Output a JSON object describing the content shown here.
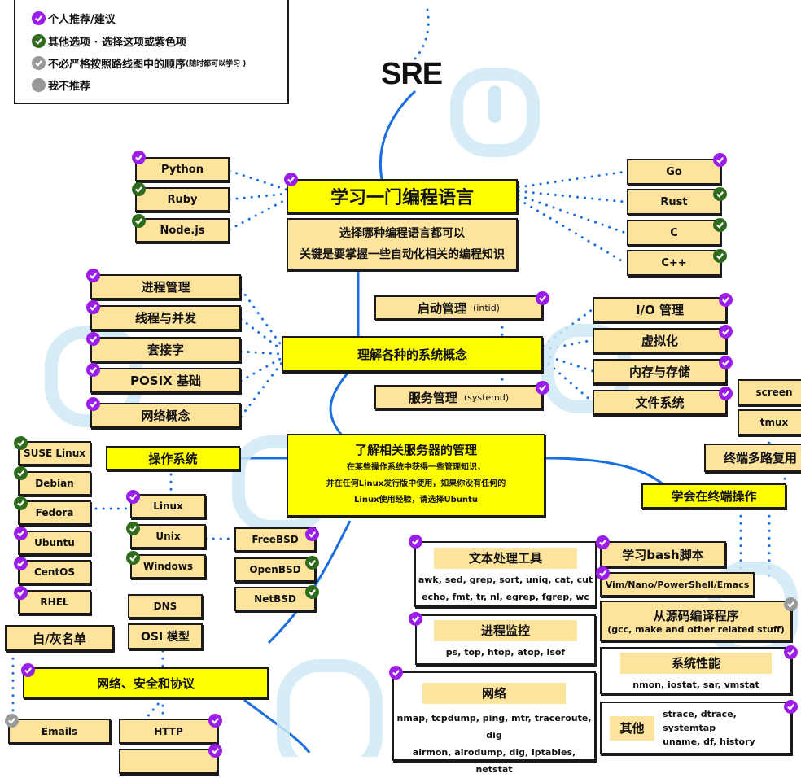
{
  "legend": {
    "items": [
      {
        "status": "purple",
        "label": "个人推荐/建议"
      },
      {
        "status": "green",
        "label": "其他选项 · 选择这项或紫色项"
      },
      {
        "status": "grey-check",
        "label": "不必严格按照路线图中的顺序",
        "note": "(随时都可以学习 )"
      },
      {
        "status": "grey",
        "label": "我不推荐"
      }
    ]
  },
  "colors": {
    "purple": "#9b1de8",
    "green": "#2f6b1c",
    "grey": "#999999",
    "node": "#fde39b",
    "main": "#ffff00",
    "line": "#1a6fe0",
    "watermark": "#cfe9f6"
  },
  "title": "SRE",
  "programming": {
    "main": "学习一门编程语言",
    "desc_line1": "选择哪种编程语言都可以",
    "desc_line2": "关键是要掌握一些自动化相关的编程知识",
    "left": [
      {
        "label": "Python",
        "status": "purple"
      },
      {
        "label": "Ruby",
        "status": "green"
      },
      {
        "label": "Node.js",
        "status": "green"
      }
    ],
    "right": [
      {
        "label": "Go",
        "status": "purple"
      },
      {
        "label": "Rust",
        "status": "green"
      },
      {
        "label": "C",
        "status": "green"
      },
      {
        "label": "C++",
        "status": "green"
      }
    ]
  },
  "concepts": {
    "main": "理解各种的系统概念",
    "left": [
      {
        "label": "进程管理"
      },
      {
        "label": "线程与并发"
      },
      {
        "label": "套接字"
      },
      {
        "label": "POSIX 基础"
      },
      {
        "label": "网络概念"
      }
    ],
    "boot": {
      "label": "启动管理",
      "sub": "(intid)"
    },
    "service": {
      "label": "服务管理",
      "sub": "(systemd)"
    },
    "right": [
      {
        "label": "I/O  管理"
      },
      {
        "label": "虚拟化"
      },
      {
        "label": "内存与存储"
      },
      {
        "label": "文件系统"
      }
    ]
  },
  "servers": {
    "main": "了解相关服务器的管理",
    "line1": "在某些操作系统中获得一些管理知识，",
    "line2": "并在任何Linux发行版中使用，如果你没有任何的",
    "line3": "Linux使用经验，请选择Ubuntu"
  },
  "os": {
    "main": "操作系统",
    "distros": [
      {
        "label": "SUSE Linux",
        "status": "green"
      },
      {
        "label": "Debian",
        "status": "green"
      },
      {
        "label": "Fedora",
        "status": "green"
      },
      {
        "label": "Ubuntu",
        "status": "purple"
      },
      {
        "label": "CentOS",
        "status": "purple"
      },
      {
        "label": "RHEL",
        "status": "purple"
      }
    ],
    "families": [
      {
        "label": "Linux",
        "status": "purple"
      },
      {
        "label": "Unix",
        "status": "green"
      },
      {
        "label": "Windows",
        "status": "green"
      }
    ],
    "bsd": [
      {
        "label": "FreeBSD",
        "status": "purple"
      },
      {
        "label": "OpenBSD",
        "status": "green"
      },
      {
        "label": "NetBSD",
        "status": "green"
      }
    ]
  },
  "network": {
    "main": "网络、安全和协议",
    "dns": "DNS",
    "osi": "OSI 模型",
    "whitelist": "白/灰名单",
    "emails": "Emails",
    "http": "HTTP"
  },
  "terminal": {
    "main": "学会在终端操作",
    "multiplex": "终端多路复用",
    "screen": "screen",
    "tmux": "tmux",
    "bash": "学习bash脚本",
    "editors": "Vim/Nano/PowerShell/Emacs",
    "compile": "从源码编译程序",
    "compile_sub": "(gcc, make and other related stuff)",
    "perf": {
      "title": "系统性能",
      "tools": "nmon, iostat, sar, vmstat"
    },
    "other": {
      "title": "其他",
      "tools_line1": "strace, dtrace, systemtap",
      "tools_line2": "uname, df, history"
    }
  },
  "tools": {
    "text": {
      "title": "文本处理工具",
      "line1": "awk, sed, grep, sort, uniq, cat, cut",
      "line2": "echo, fmt, tr, nl, egrep, fgrep, wc"
    },
    "proc": {
      "title": "进程监控",
      "line1": "ps, top, htop, atop, lsof"
    },
    "net": {
      "title": "网络",
      "line1": "nmap, tcpdump, ping, mtr, traceroute, dig",
      "line2": "airmon, airodump, dig, iptables, netstat"
    }
  }
}
